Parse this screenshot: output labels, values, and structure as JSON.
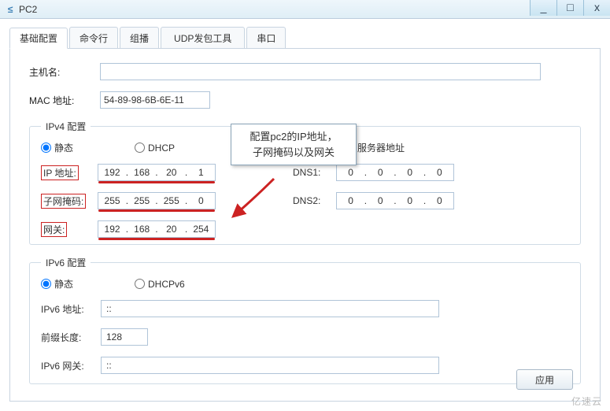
{
  "window": {
    "title": "PC2",
    "min": "_",
    "max": "□",
    "close": "x"
  },
  "tabs": {
    "basic": "基础配置",
    "cli": "命令行",
    "multicast": "组播",
    "udp": "UDP发包工具",
    "serial": "串口"
  },
  "host": {
    "label": "主机名:",
    "value": ""
  },
  "mac": {
    "label": "MAC 地址:",
    "value": "54-89-98-6B-6E-11"
  },
  "callout": {
    "line1": "配置pc2的IP地址，",
    "line2": "子网掩码以及网关"
  },
  "ipv4": {
    "legend": "IPv4 配置",
    "static": "静态",
    "dhcp": "DHCP",
    "auto_dns": "自动获取 DNS 服务器地址",
    "ip_label": "IP 地址:",
    "ip": [
      "192",
      "168",
      "20",
      "1"
    ],
    "mask_label": "子网掩码:",
    "mask": [
      "255",
      "255",
      "255",
      "0"
    ],
    "gw_label": "网关:",
    "gw": [
      "192",
      "168",
      "20",
      "254"
    ],
    "dns1_label": "DNS1:",
    "dns1": [
      "0",
      "0",
      "0",
      "0"
    ],
    "dns2_label": "DNS2:",
    "dns2": [
      "0",
      "0",
      "0",
      "0"
    ]
  },
  "ipv6": {
    "legend": "IPv6 配置",
    "static": "静态",
    "dhcp": "DHCPv6",
    "addr_label": "IPv6 地址:",
    "addr": "::",
    "prefix_label": "前缀长度:",
    "prefix": "128",
    "gw_label": "IPv6 网关:",
    "gw": "::"
  },
  "apply": "应用",
  "watermark": "亿速云"
}
